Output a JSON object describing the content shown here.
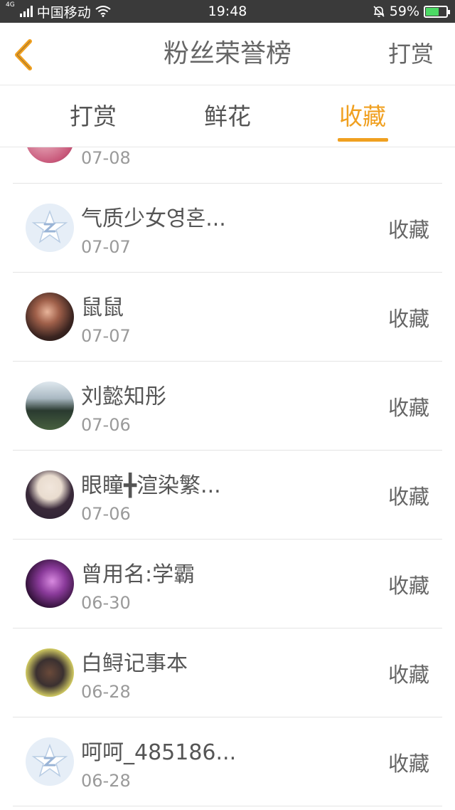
{
  "status_bar": {
    "network": "4G",
    "carrier": "中国移动",
    "time": "19:48",
    "battery": "59%",
    "battery_level": 0.59,
    "icons": [
      "signal-icon",
      "wifi-icon",
      "mute-bell-icon",
      "battery-charging-icon"
    ]
  },
  "header": {
    "back_icon": "chevron-left-icon",
    "title": "粉丝荣誉榜",
    "action_label": "打赏"
  },
  "tabs": [
    {
      "label": "打赏",
      "active": false
    },
    {
      "label": "鲜花",
      "active": false
    },
    {
      "label": "收藏",
      "active": true
    }
  ],
  "colors": {
    "accent": "#f0a020",
    "text": "#555555",
    "muted": "#9a9a9a",
    "divider": "#e4e4e4"
  },
  "list": [
    {
      "name": "",
      "date": "07-08",
      "action": "",
      "avatar": "photo-pink"
    },
    {
      "name": "气质少女영혼...",
      "date": "07-07",
      "action": "收藏",
      "avatar": "default-qq"
    },
    {
      "name": "鼠鼠",
      "date": "07-07",
      "action": "收藏",
      "avatar": "photo-portrait"
    },
    {
      "name": "刘懿知彤",
      "date": "07-06",
      "action": "收藏",
      "avatar": "photo-penguins"
    },
    {
      "name": "眼瞳╋渲染繁...",
      "date": "07-06",
      "action": "收藏",
      "avatar": "photo-girl"
    },
    {
      "name": "曾用名:学霸",
      "date": "06-30",
      "action": "收藏",
      "avatar": "photo-purple"
    },
    {
      "name": "白鲟记事本",
      "date": "06-28",
      "action": "收藏",
      "avatar": "photo-group"
    },
    {
      "name": "呵呵_485186...",
      "date": "06-28",
      "action": "收藏",
      "avatar": "default-qq"
    }
  ]
}
